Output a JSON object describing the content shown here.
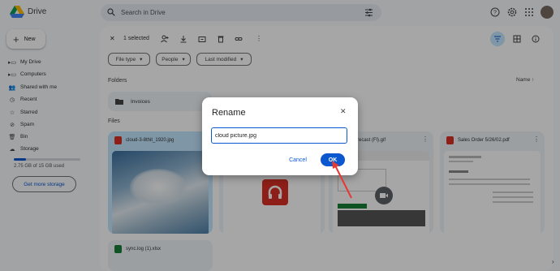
{
  "app": {
    "name": "Drive"
  },
  "search": {
    "placeholder": "Search in Drive"
  },
  "sidebar": {
    "new_label": "New",
    "items": [
      {
        "label": "My Drive",
        "icon": "drive-icon"
      },
      {
        "label": "Computers",
        "icon": "computer-icon"
      },
      {
        "label": "Shared with me",
        "icon": "people-icon"
      },
      {
        "label": "Recent",
        "icon": "clock-icon"
      },
      {
        "label": "Starred",
        "icon": "star-icon"
      },
      {
        "label": "Spam",
        "icon": "spam-icon"
      },
      {
        "label": "Bin",
        "icon": "trash-icon"
      },
      {
        "label": "Storage",
        "icon": "cloud-icon"
      }
    ],
    "storage_text": "2.75 GB of 15 GB used",
    "storage_fraction": 0.18,
    "get_more_label": "Get more storage"
  },
  "toolbar": {
    "selected_label": "1 selected"
  },
  "filters": [
    {
      "label": "File type"
    },
    {
      "label": "People"
    },
    {
      "label": "Last modified"
    }
  ],
  "sections": {
    "folders": "Folders",
    "files": "Files",
    "sort_label": "Name"
  },
  "folder": {
    "name": "Invoices"
  },
  "files": [
    {
      "title": "cloud-3-8thit_1920.jpg",
      "icon_color": "#d93025"
    },
    {
      "title": "",
      "icon_color": "#d93025"
    },
    {
      "title": "ex forecast (Fl).gif",
      "icon_color": "#5f6368"
    },
    {
      "title": "Sales Order 5/26/02.pdf",
      "icon_color": "#d93025"
    },
    {
      "title": "sync.log (1).xlsx",
      "icon_color": "#188038"
    }
  ],
  "dialog": {
    "title": "Rename",
    "input_value": "cloud picture.jpg",
    "cancel_label": "Cancel",
    "ok_label": "OK"
  },
  "colors": {
    "accent": "#0b57d0",
    "annotation": "#e53935"
  }
}
